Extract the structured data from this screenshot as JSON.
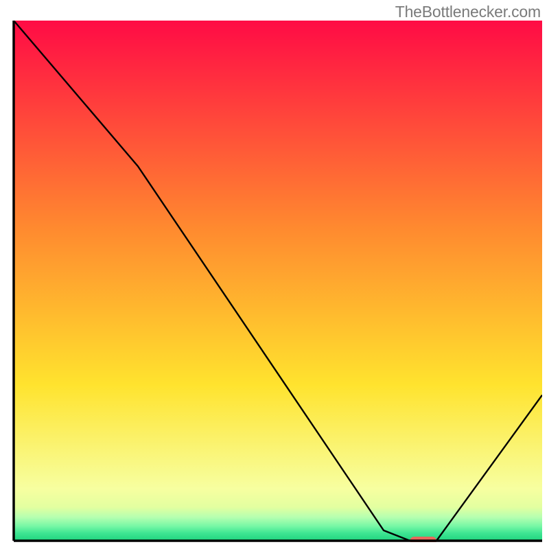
{
  "watermark": "TheBottlenecker.com",
  "chart_data": {
    "type": "line",
    "title": "",
    "xlabel": "",
    "ylabel": "",
    "xlim": [
      0,
      100
    ],
    "ylim": [
      0,
      100
    ],
    "series": [
      {
        "name": "curve",
        "points": [
          {
            "x": 0,
            "y": 100
          },
          {
            "x": 23.5,
            "y": 72
          },
          {
            "x": 70,
            "y": 2
          },
          {
            "x": 75,
            "y": 0
          },
          {
            "x": 80,
            "y": 0
          },
          {
            "x": 100,
            "y": 28
          }
        ]
      }
    ],
    "marker": {
      "x_start": 75,
      "x_end": 80,
      "y": 0
    },
    "gradient_stops": [
      {
        "offset": 0.0,
        "color": "#ff0b45"
      },
      {
        "offset": 0.4,
        "color": "#ff8a2f"
      },
      {
        "offset": 0.7,
        "color": "#ffe32e"
      },
      {
        "offset": 0.9,
        "color": "#f7ffa0"
      },
      {
        "offset": 0.935,
        "color": "#e3ffa0"
      },
      {
        "offset": 0.955,
        "color": "#b5ffb0"
      },
      {
        "offset": 0.972,
        "color": "#76f7a5"
      },
      {
        "offset": 0.985,
        "color": "#3fe693"
      },
      {
        "offset": 1.0,
        "color": "#1fd47f"
      }
    ],
    "marker_color": "#e6695c",
    "axis_color": "#000000"
  }
}
